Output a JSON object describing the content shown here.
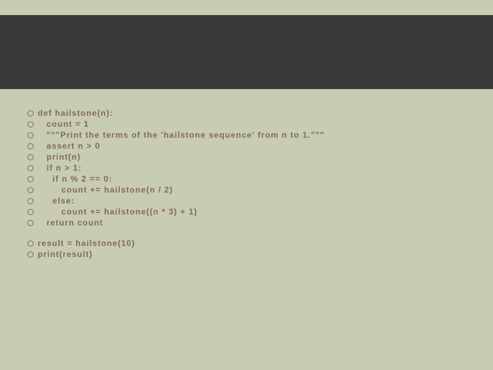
{
  "code_block_1": [
    "def hailstone(n):",
    "   count = 1",
    "   \"\"\"Print the terms of the 'hailstone sequence' from n to 1.\"\"\"",
    "   assert n > 0",
    "   print(n)",
    "   if n > 1:",
    "     if n % 2 == 0:",
    "        count += hailstone(n / 2)",
    "     else:",
    "        count += hailstone((n * 3) + 1)",
    "   return count"
  ],
  "code_block_2": [
    "result = hailstone(10)",
    "print(result)"
  ]
}
